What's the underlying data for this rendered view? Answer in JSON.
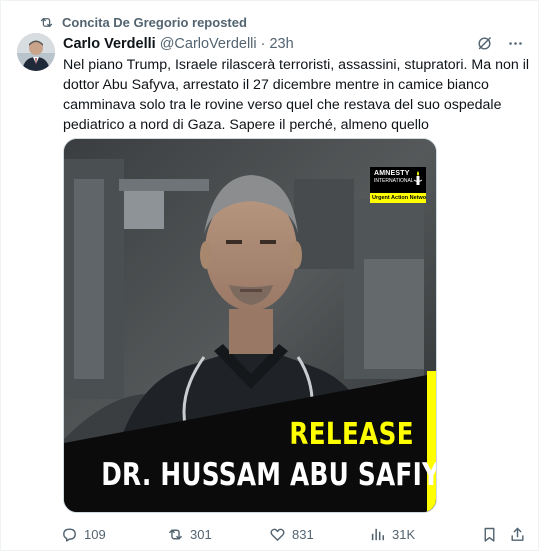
{
  "repost": {
    "text": "Concita De Gregorio reposted",
    "icon": "repost-icon"
  },
  "author": {
    "name": "Carlo Verdelli",
    "handle": "@CarloVerdelli",
    "separator": "·",
    "time": "23h"
  },
  "header_icons": [
    "grok-icon",
    "more-icon"
  ],
  "tweet_text": "Nel piano Trump, Israele rilascerà terroristi, assassini, stupratori. Ma non il dottor Abu Safyva, arrestato il 27 dicembre mentre in camice bianco camminava solo tra le rovine verso quel che restava del suo ospedale pediatrico a nord di Gaza. Sapere il perché, almeno quello",
  "media": {
    "logo_line1": "AMNESTY",
    "logo_line2": "INTERNATIONAL",
    "logo_tag": "Urgent Action Network",
    "headline": "RELEASE",
    "subject": "DR. HUSSAM ABU SAFIYA",
    "accent_color": "#ffff00"
  },
  "actions": {
    "replies": "109",
    "reposts": "301",
    "likes": "831",
    "views": "31K"
  },
  "colors": {
    "text": "#0f1419",
    "secondary": "#536471"
  }
}
